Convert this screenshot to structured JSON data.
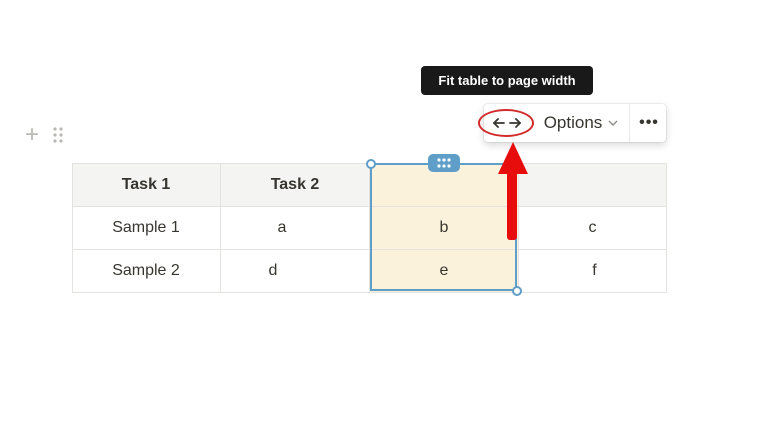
{
  "tooltip": {
    "text": "Fit table to page width"
  },
  "toolbar": {
    "fit_icon": "arrows-horizontal-icon",
    "options_label": "Options",
    "options_caret": "⌄",
    "more_label": "•••"
  },
  "block": {
    "add_icon": "+"
  },
  "table": {
    "headers": [
      "Task 1",
      "Task 2",
      "",
      ""
    ],
    "rows": [
      [
        "Sample 1",
        "a",
        "b",
        "c"
      ],
      [
        "Sample 2",
        "d",
        "e",
        "f"
      ]
    ],
    "selected_column": 3
  },
  "colors": {
    "selection": "#5f9ec8",
    "selected_fill": "#fbf2db",
    "annotation": "#e80d0d",
    "tooltip_bg": "#191919"
  }
}
